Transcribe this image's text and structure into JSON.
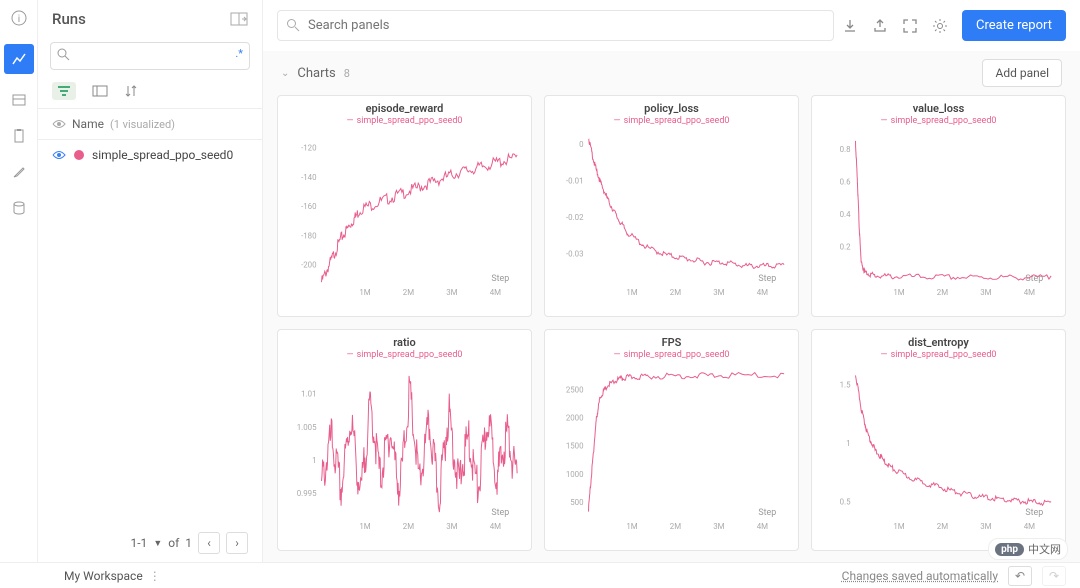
{
  "iconbar": {
    "items": [
      "info-icon",
      "chart-icon",
      "table-icon",
      "clipboard-icon",
      "brush-icon",
      "database-icon"
    ],
    "active_index": 1
  },
  "sidebar": {
    "title": "Runs",
    "search_placeholder": "",
    "name_header": "Name",
    "visualized_text": "(1 visualized)",
    "runs": [
      {
        "name": "simple_spread_ppo_seed0",
        "color": "#e85d8c"
      }
    ],
    "pager": {
      "range": "1-1",
      "of_label": "of",
      "total": "1"
    }
  },
  "main": {
    "search_placeholder": "Search panels",
    "create_button": "Create report",
    "section_title": "Charts",
    "chart_count": "8",
    "add_panel_button": "Add panel"
  },
  "footer": {
    "workspace": "My Workspace",
    "save_status": "Changes saved automatically"
  },
  "watermark": "中文网",
  "chart_data": [
    {
      "type": "line",
      "title": "episode_reward",
      "legend": "simple_spread_ppo_seed0",
      "xlabel": "Step",
      "xticks": [
        "1M",
        "2M",
        "3M",
        "4M"
      ],
      "yticks": [
        -200,
        -180,
        -160,
        -140,
        -120
      ],
      "ylim": [
        -210,
        -110
      ],
      "x": [
        0,
        0.05,
        0.1,
        0.15,
        0.2,
        0.3,
        0.4,
        0.5,
        0.6,
        0.7,
        0.8,
        0.9,
        1.0
      ],
      "y": [
        -210,
        -195,
        -180,
        -170,
        -160,
        -155,
        -150,
        -145,
        -140,
        -135,
        -132,
        -128,
        -125
      ]
    },
    {
      "type": "line",
      "title": "policy_loss",
      "legend": "simple_spread_ppo_seed0",
      "xlabel": "Step",
      "xticks": [
        "1M",
        "2M",
        "3M",
        "4M"
      ],
      "yticks": [
        -0.03,
        -0.02,
        -0.01,
        0
      ],
      "ylim": [
        -0.037,
        0.003
      ],
      "x": [
        0,
        0.03,
        0.06,
        0.1,
        0.15,
        0.2,
        0.3,
        0.4,
        0.5,
        0.6,
        0.7,
        0.8,
        0.9,
        1.0
      ],
      "y": [
        0.002,
        -0.005,
        -0.01,
        -0.015,
        -0.02,
        -0.024,
        -0.028,
        -0.03,
        -0.031,
        -0.032,
        -0.032,
        -0.033,
        -0.033,
        -0.033
      ]
    },
    {
      "type": "line",
      "title": "value_loss",
      "legend": "simple_spread_ppo_seed0",
      "xlabel": "Step",
      "xticks": [
        "1M",
        "2M",
        "3M",
        "4M"
      ],
      "yticks": [
        0.2,
        0.4,
        0.6,
        0.8
      ],
      "ylim": [
        0,
        0.9
      ],
      "x": [
        0,
        0.01,
        0.02,
        0.03,
        0.05,
        0.1,
        0.2,
        0.4,
        0.6,
        0.8,
        1.0
      ],
      "y": [
        0.85,
        0.6,
        0.3,
        0.1,
        0.05,
        0.03,
        0.025,
        0.022,
        0.02,
        0.02,
        0.02
      ]
    },
    {
      "type": "line",
      "title": "ratio",
      "legend": "simple_spread_ppo_seed0",
      "xlabel": "Step",
      "xticks": [
        "1M",
        "2M",
        "3M",
        "4M"
      ],
      "yticks": [
        0.995,
        1,
        1.005,
        1.01
      ],
      "ylim": [
        0.992,
        1.014
      ],
      "x": [
        0,
        0.05,
        0.1,
        0.15,
        0.2,
        0.25,
        0.3,
        0.35,
        0.4,
        0.45,
        0.5,
        0.55,
        0.6,
        0.65,
        0.7,
        0.75,
        0.8,
        0.85,
        0.9,
        0.95,
        1.0
      ],
      "y": [
        0.998,
        1.005,
        0.997,
        1.008,
        0.996,
        1.01,
        0.999,
        1.006,
        0.997,
        1.012,
        0.998,
        1.007,
        0.996,
        1.009,
        0.998,
        1.005,
        0.997,
        1.008,
        0.999,
        1.006,
        0.998
      ]
    },
    {
      "type": "line",
      "title": "FPS",
      "legend": "simple_spread_ppo_seed0",
      "xlabel": "Step",
      "xticks": [
        "1M",
        "2M",
        "3M",
        "4M"
      ],
      "yticks": [
        500,
        1000,
        1500,
        2000,
        2500
      ],
      "ylim": [
        300,
        2900
      ],
      "x": [
        0,
        0.02,
        0.04,
        0.06,
        0.1,
        0.15,
        0.2,
        0.3,
        0.5,
        0.7,
        1.0
      ],
      "y": [
        400,
        1200,
        2000,
        2400,
        2600,
        2700,
        2740,
        2760,
        2770,
        2775,
        2780
      ]
    },
    {
      "type": "line",
      "title": "dist_entropy",
      "legend": "simple_spread_ppo_seed0",
      "xlabel": "Step",
      "xticks": [
        "1M",
        "2M",
        "3M",
        "4M"
      ],
      "yticks": [
        0.5,
        1,
        1.5
      ],
      "ylim": [
        0.4,
        1.65
      ],
      "x": [
        0,
        0.03,
        0.06,
        0.1,
        0.15,
        0.2,
        0.3,
        0.4,
        0.5,
        0.6,
        0.7,
        0.8,
        0.9,
        1.0
      ],
      "y": [
        1.6,
        1.3,
        1.1,
        0.95,
        0.85,
        0.78,
        0.7,
        0.65,
        0.6,
        0.56,
        0.54,
        0.52,
        0.51,
        0.5
      ]
    }
  ]
}
